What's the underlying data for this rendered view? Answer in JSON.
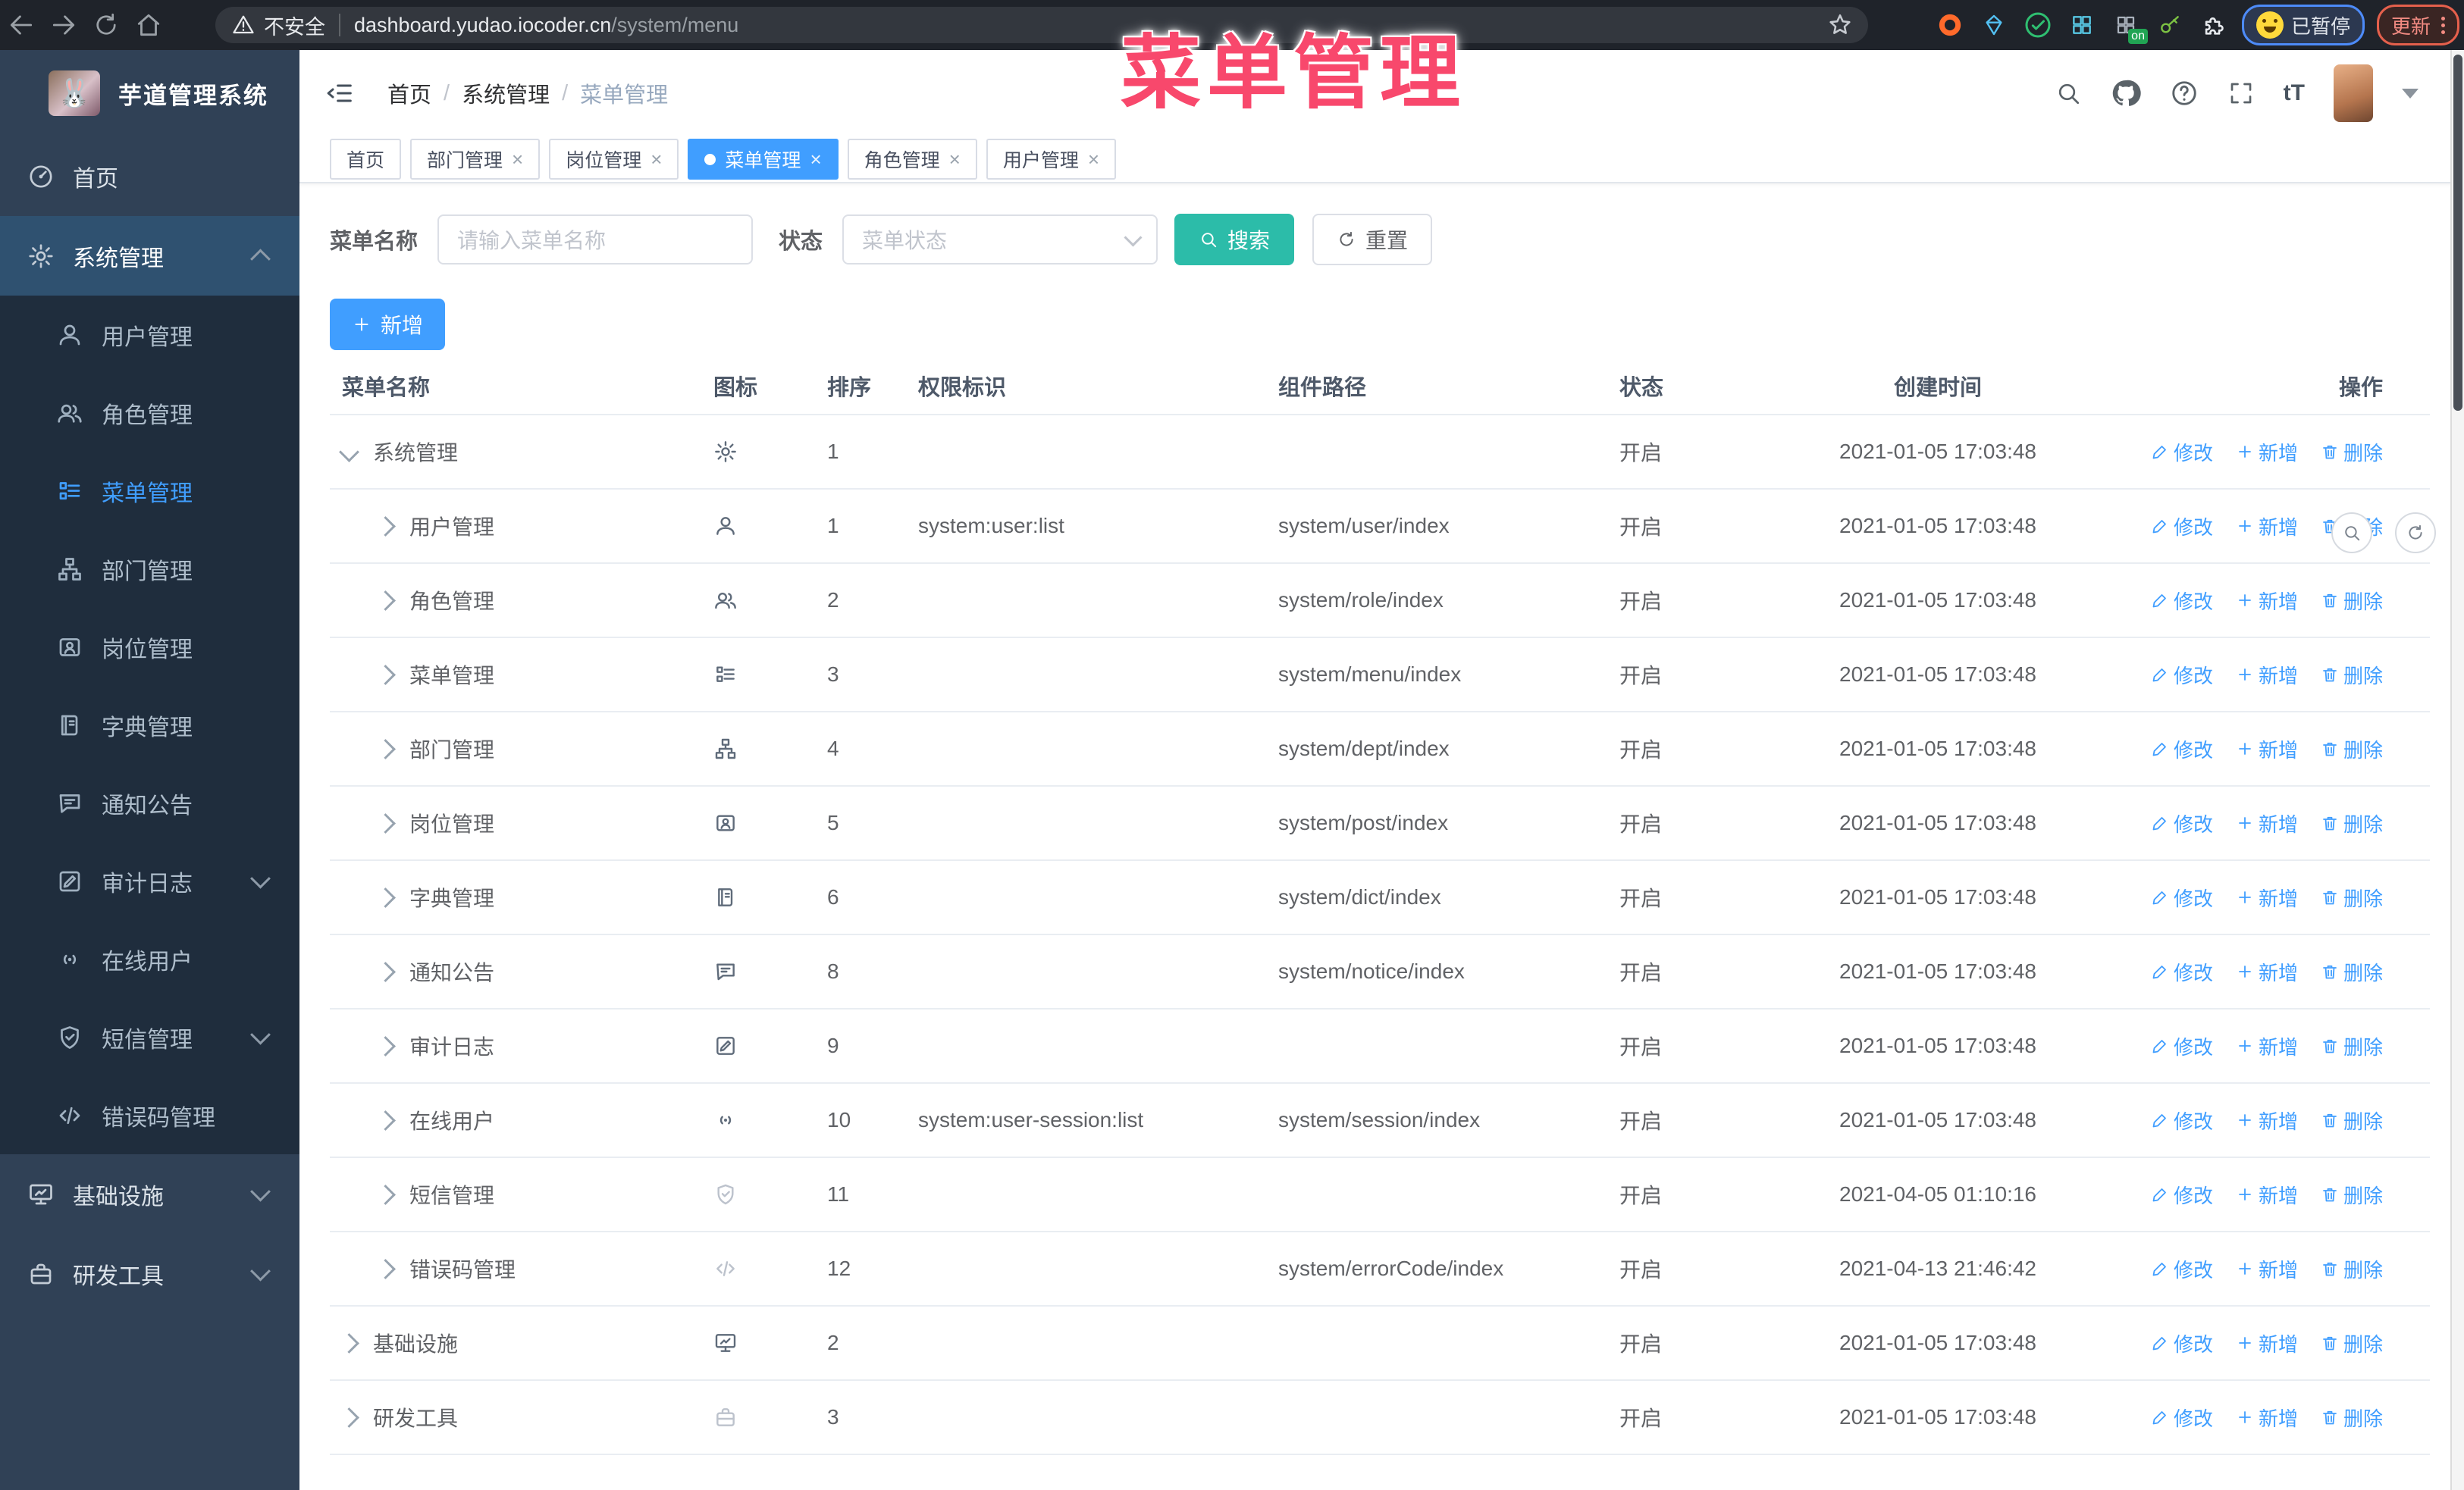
{
  "colors": {
    "accent": "#409eff",
    "teal": "#2cbca9",
    "pink": "#f8486c",
    "sidebar_bg": "#304156",
    "submenu_bg": "#1f2d3d"
  },
  "overlay": {
    "title": "菜单管理"
  },
  "browser": {
    "security_text": "不安全",
    "url_host": "dashboard.yudao.iocoder.cn",
    "url_path": "/system/menu",
    "paused_label": "已暂停",
    "update_label": "更新"
  },
  "sidebar": {
    "logo_title": "芋道管理系统",
    "items": [
      {
        "label": "首页",
        "icon": "dashboard",
        "level": 0,
        "caret": null,
        "state": "normal"
      },
      {
        "label": "系统管理",
        "icon": "gear",
        "level": 0,
        "caret": "up",
        "state": "opened"
      },
      {
        "label": "用户管理",
        "icon": "user",
        "level": 1,
        "caret": null,
        "state": "normal"
      },
      {
        "label": "角色管理",
        "icon": "users",
        "level": 1,
        "caret": null,
        "state": "normal"
      },
      {
        "label": "菜单管理",
        "icon": "menu",
        "level": 1,
        "caret": null,
        "state": "active"
      },
      {
        "label": "部门管理",
        "icon": "tree",
        "level": 1,
        "caret": null,
        "state": "normal"
      },
      {
        "label": "岗位管理",
        "icon": "post",
        "level": 1,
        "caret": null,
        "state": "normal"
      },
      {
        "label": "字典管理",
        "icon": "dict",
        "level": 1,
        "caret": null,
        "state": "normal"
      },
      {
        "label": "通知公告",
        "icon": "message",
        "level": 1,
        "caret": null,
        "state": "normal"
      },
      {
        "label": "审计日志",
        "icon": "log",
        "level": 1,
        "caret": "down",
        "state": "normal"
      },
      {
        "label": "在线用户",
        "icon": "online",
        "level": 1,
        "caret": null,
        "state": "normal"
      },
      {
        "label": "短信管理",
        "icon": "sms",
        "level": 1,
        "caret": "down",
        "state": "normal"
      },
      {
        "label": "错误码管理",
        "icon": "code",
        "level": 1,
        "caret": null,
        "state": "normal"
      },
      {
        "label": "基础设施",
        "icon": "monitor",
        "level": 0,
        "caret": "down",
        "state": "normal"
      },
      {
        "label": "研发工具",
        "icon": "tool",
        "level": 0,
        "caret": "down",
        "state": "normal"
      }
    ]
  },
  "breadcrumb": [
    "首页",
    "系统管理",
    "菜单管理"
  ],
  "tags": [
    {
      "label": "首页",
      "closable": false,
      "active": false
    },
    {
      "label": "部门管理",
      "closable": true,
      "active": false
    },
    {
      "label": "岗位管理",
      "closable": true,
      "active": false
    },
    {
      "label": "菜单管理",
      "closable": true,
      "active": true
    },
    {
      "label": "角色管理",
      "closable": true,
      "active": false
    },
    {
      "label": "用户管理",
      "closable": true,
      "active": false
    }
  ],
  "filters": {
    "name_label": "菜单名称",
    "name_placeholder": "请输入菜单名称",
    "status_label": "状态",
    "status_placeholder": "菜单状态",
    "search_label": "搜索",
    "reset_label": "重置"
  },
  "toolbar": {
    "add_label": "新增"
  },
  "table": {
    "columns": [
      "菜单名称",
      "图标",
      "排序",
      "权限标识",
      "组件路径",
      "状态",
      "创建时间",
      "操作"
    ],
    "ops": [
      {
        "label": "修改",
        "icon": "edit"
      },
      {
        "label": "新增",
        "icon": "plus"
      },
      {
        "label": "删除",
        "icon": "trash"
      }
    ],
    "rows": [
      {
        "level": 0,
        "arrow": "down",
        "name": "系统管理",
        "icon": "gear",
        "muted": false,
        "sort": "1",
        "perm": "",
        "path": "",
        "status": "开启",
        "time": "2021-01-05 17:03:48"
      },
      {
        "level": 1,
        "arrow": "right",
        "name": "用户管理",
        "icon": "user",
        "muted": false,
        "sort": "1",
        "perm": "system:user:list",
        "path": "system/user/index",
        "status": "开启",
        "time": "2021-01-05 17:03:48"
      },
      {
        "level": 1,
        "arrow": "right",
        "name": "角色管理",
        "icon": "users",
        "muted": false,
        "sort": "2",
        "perm": "",
        "path": "system/role/index",
        "status": "开启",
        "time": "2021-01-05 17:03:48"
      },
      {
        "level": 1,
        "arrow": "right",
        "name": "菜单管理",
        "icon": "menu",
        "muted": false,
        "sort": "3",
        "perm": "",
        "path": "system/menu/index",
        "status": "开启",
        "time": "2021-01-05 17:03:48"
      },
      {
        "level": 1,
        "arrow": "right",
        "name": "部门管理",
        "icon": "tree",
        "muted": false,
        "sort": "4",
        "perm": "",
        "path": "system/dept/index",
        "status": "开启",
        "time": "2021-01-05 17:03:48"
      },
      {
        "level": 1,
        "arrow": "right",
        "name": "岗位管理",
        "icon": "post",
        "muted": false,
        "sort": "5",
        "perm": "",
        "path": "system/post/index",
        "status": "开启",
        "time": "2021-01-05 17:03:48"
      },
      {
        "level": 1,
        "arrow": "right",
        "name": "字典管理",
        "icon": "dict",
        "muted": false,
        "sort": "6",
        "perm": "",
        "path": "system/dict/index",
        "status": "开启",
        "time": "2021-01-05 17:03:48"
      },
      {
        "level": 1,
        "arrow": "right",
        "name": "通知公告",
        "icon": "message",
        "muted": false,
        "sort": "8",
        "perm": "",
        "path": "system/notice/index",
        "status": "开启",
        "time": "2021-01-05 17:03:48"
      },
      {
        "level": 1,
        "arrow": "right",
        "name": "审计日志",
        "icon": "log",
        "muted": false,
        "sort": "9",
        "perm": "",
        "path": "",
        "status": "开启",
        "time": "2021-01-05 17:03:48"
      },
      {
        "level": 1,
        "arrow": "right",
        "name": "在线用户",
        "icon": "online",
        "muted": false,
        "sort": "10",
        "perm": "system:user-session:list",
        "path": "system/session/index",
        "status": "开启",
        "time": "2021-01-05 17:03:48"
      },
      {
        "level": 1,
        "arrow": "right",
        "name": "短信管理",
        "icon": "sms",
        "muted": true,
        "sort": "11",
        "perm": "",
        "path": "",
        "status": "开启",
        "time": "2021-04-05 01:10:16"
      },
      {
        "level": 1,
        "arrow": "right",
        "name": "错误码管理",
        "icon": "code",
        "muted": true,
        "sort": "12",
        "perm": "",
        "path": "system/errorCode/index",
        "status": "开启",
        "time": "2021-04-13 21:46:42"
      },
      {
        "level": 0,
        "arrow": "right",
        "name": "基础设施",
        "icon": "monitor",
        "muted": false,
        "sort": "2",
        "perm": "",
        "path": "",
        "status": "开启",
        "time": "2021-01-05 17:03:48"
      },
      {
        "level": 0,
        "arrow": "right",
        "name": "研发工具",
        "icon": "tool",
        "muted": true,
        "sort": "3",
        "perm": "",
        "path": "",
        "status": "开启",
        "time": "2021-01-05 17:03:48"
      }
    ]
  }
}
